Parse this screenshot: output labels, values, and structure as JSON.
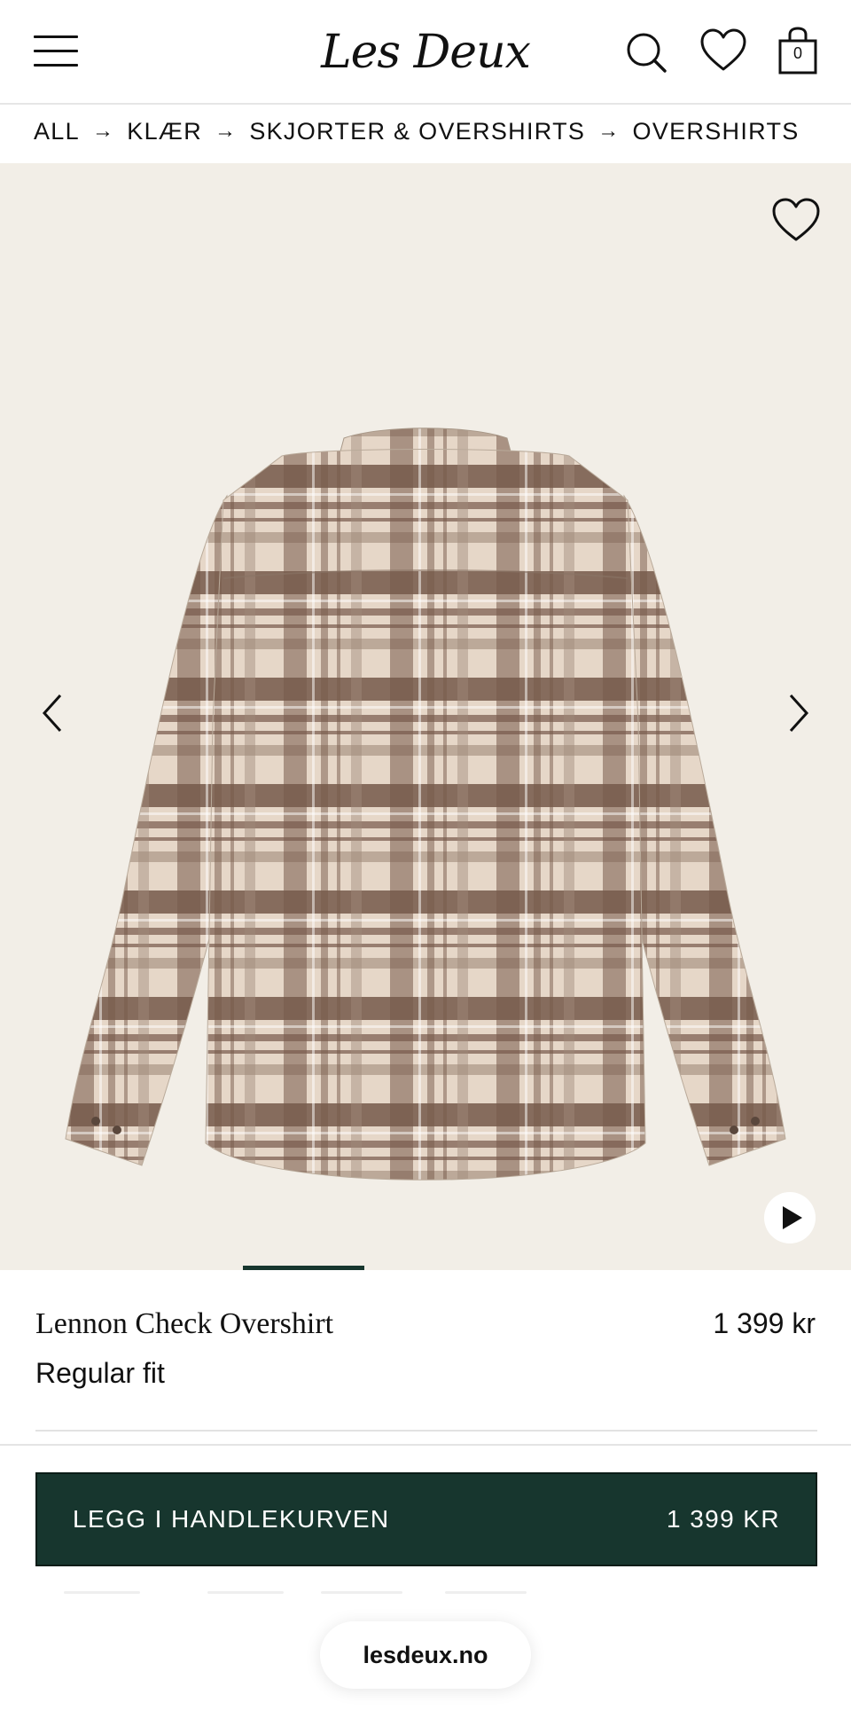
{
  "header": {
    "logo": "Les Deux",
    "menu_icon": "hamburger-menu-icon",
    "search_icon": "search-icon",
    "wishlist_icon": "heart-icon",
    "cart_icon": "shopping-bag-icon",
    "cart_count": "0"
  },
  "breadcrumb": {
    "items": [
      "ALL",
      "KLÆR",
      "SKJORTER & OVERSHIRTS",
      "OVERSHIRTS"
    ],
    "separator": "→"
  },
  "gallery": {
    "wishlist_icon": "heart-icon",
    "prev_icon": "chevron-left-icon",
    "next_icon": "chevron-right-icon",
    "play_icon": "play-icon",
    "image_subject": "plaid overshirt back view",
    "current_slide_fraction": 0.143,
    "colors": {
      "background": "#f2eee7",
      "shirt_light": "#e6d7c8",
      "shirt_dark": "#76594a",
      "progress": "#17362e"
    }
  },
  "product": {
    "name": "Lennon Check Overshirt",
    "price": "1 399 kr",
    "fit": "Regular fit"
  },
  "cta": {
    "label": "LEGG I HANDLEKURVEN",
    "price": "1 399 KR",
    "color": "#17362e"
  },
  "browser": {
    "domain": "lesdeux.no"
  }
}
